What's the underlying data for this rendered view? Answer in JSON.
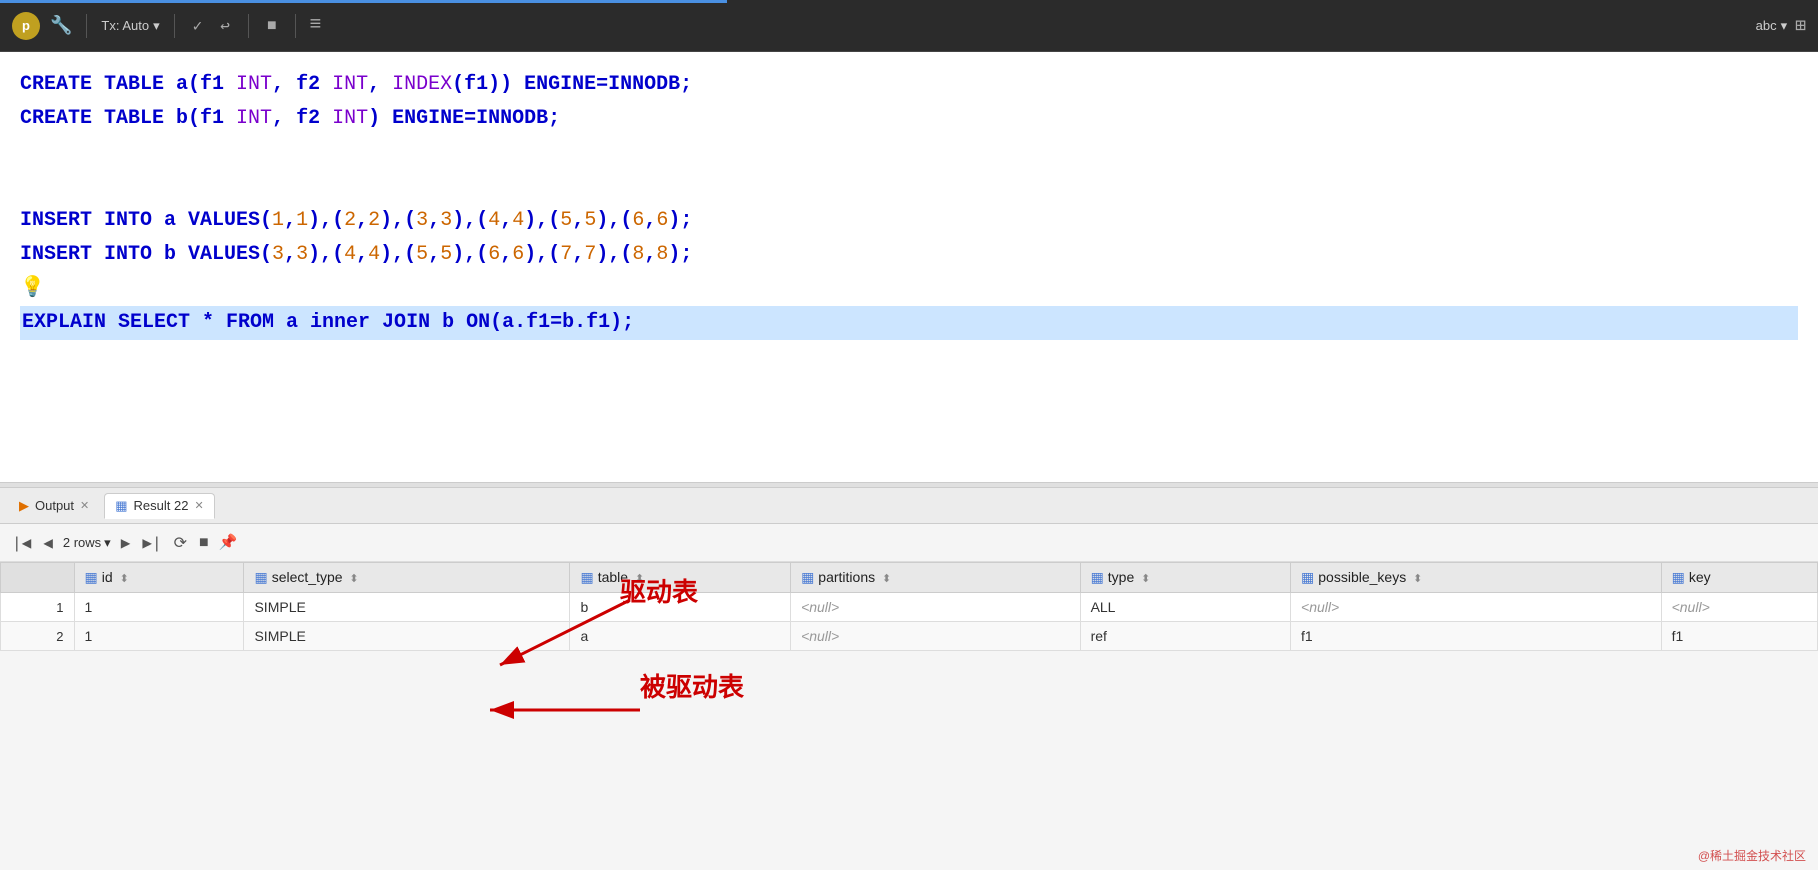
{
  "toolbar": {
    "avatar_label": "p",
    "tx_label": "Tx: Auto",
    "chevron": "▾",
    "check_icon": "✓",
    "undo_icon": "↩",
    "stop_icon": "■",
    "grid_icon": "≡",
    "abc_label": "abc",
    "abc_chevron": "▾",
    "right_icon": "⊞"
  },
  "editor": {
    "lines": [
      {
        "parts": [
          {
            "text": "CREATE TABLE a(f1 ",
            "cls": "kw"
          },
          {
            "text": "INT",
            "cls": "fn"
          },
          {
            "text": ", f2 ",
            "cls": "kw"
          },
          {
            "text": "INT",
            "cls": "fn"
          },
          {
            "text": ", ",
            "cls": "kw"
          },
          {
            "text": "INDEX",
            "cls": "fn"
          },
          {
            "text": "(f1)) ENGINE=INNODB;",
            "cls": "kw"
          }
        ]
      },
      {
        "parts": [
          {
            "text": "CREATE TABLE b(f1 ",
            "cls": "kw"
          },
          {
            "text": "INT",
            "cls": "fn"
          },
          {
            "text": ", f2 ",
            "cls": "kw"
          },
          {
            "text": "INT",
            "cls": "fn"
          },
          {
            "text": ") ENGINE=INNODB;",
            "cls": "kw"
          }
        ]
      },
      {
        "parts": [
          {
            "text": "",
            "cls": ""
          }
        ]
      },
      {
        "parts": [
          {
            "text": "",
            "cls": ""
          }
        ]
      },
      {
        "parts": [
          {
            "text": "INSERT INTO a VALUES(",
            "cls": "kw"
          },
          {
            "text": "1",
            "cls": "num"
          },
          {
            "text": ",",
            "cls": "kw"
          },
          {
            "text": "1",
            "cls": "num"
          },
          {
            "text": "),(",
            "cls": "kw"
          },
          {
            "text": "2",
            "cls": "num"
          },
          {
            "text": ",",
            "cls": "kw"
          },
          {
            "text": "2",
            "cls": "num"
          },
          {
            "text": "),(",
            "cls": "kw"
          },
          {
            "text": "3",
            "cls": "num"
          },
          {
            "text": ",",
            "cls": "kw"
          },
          {
            "text": "3",
            "cls": "num"
          },
          {
            "text": "),(",
            "cls": "kw"
          },
          {
            "text": "4",
            "cls": "num"
          },
          {
            "text": ",",
            "cls": "kw"
          },
          {
            "text": "4",
            "cls": "num"
          },
          {
            "text": "),(",
            "cls": "kw"
          },
          {
            "text": "5",
            "cls": "num"
          },
          {
            "text": ",",
            "cls": "kw"
          },
          {
            "text": "5",
            "cls": "num"
          },
          {
            "text": "),(",
            "cls": "kw"
          },
          {
            "text": "6",
            "cls": "num"
          },
          {
            "text": ",",
            "cls": "kw"
          },
          {
            "text": "6",
            "cls": "num"
          },
          {
            "text": ");",
            "cls": "kw"
          }
        ]
      },
      {
        "parts": [
          {
            "text": "INSERT INTO b VALUES(",
            "cls": "kw"
          },
          {
            "text": "3",
            "cls": "num"
          },
          {
            "text": ",",
            "cls": "kw"
          },
          {
            "text": "3",
            "cls": "num"
          },
          {
            "text": "),(",
            "cls": "kw"
          },
          {
            "text": "4",
            "cls": "num"
          },
          {
            "text": ",",
            "cls": "kw"
          },
          {
            "text": "4",
            "cls": "num"
          },
          {
            "text": "),(",
            "cls": "kw"
          },
          {
            "text": "5",
            "cls": "num"
          },
          {
            "text": ",",
            "cls": "kw"
          },
          {
            "text": "5",
            "cls": "num"
          },
          {
            "text": "),(",
            "cls": "kw"
          },
          {
            "text": "6",
            "cls": "num"
          },
          {
            "text": ",",
            "cls": "kw"
          },
          {
            "text": "6",
            "cls": "num"
          },
          {
            "text": "),(",
            "cls": "kw"
          },
          {
            "text": "7",
            "cls": "num"
          },
          {
            "text": ",",
            "cls": "kw"
          },
          {
            "text": "7",
            "cls": "num"
          },
          {
            "text": "),(",
            "cls": "kw"
          },
          {
            "text": "8",
            "cls": "num"
          },
          {
            "text": ",",
            "cls": "kw"
          },
          {
            "text": "8",
            "cls": "num"
          },
          {
            "text": ");",
            "cls": "kw"
          }
        ]
      },
      {
        "parts": [
          {
            "text": "💡",
            "cls": ""
          }
        ]
      },
      {
        "highlighted": true,
        "parts": [
          {
            "text": "EXPLAIN SELECT * FROM a inner JOIN b ON(a.f1=b.f1);",
            "cls": "kw"
          }
        ]
      }
    ]
  },
  "tabs": [
    {
      "label": "Output",
      "icon": "output",
      "active": false,
      "closable": true
    },
    {
      "label": "Result 22",
      "icon": "table",
      "active": true,
      "closable": true
    }
  ],
  "results_toolbar": {
    "first_icon": "|◀",
    "prev_icon": "◀",
    "rows_label": "2 rows",
    "rows_chevron": "▾",
    "next_icon": "▶",
    "last_icon": "▶|",
    "refresh_icon": "⟳",
    "stop_icon": "■",
    "pin_icon": "📌"
  },
  "table": {
    "columns": [
      "id",
      "select_type",
      "table",
      "partitions",
      "type",
      "possible_keys",
      "key"
    ],
    "rows": [
      {
        "id": "1",
        "select_type": "SIMPLE",
        "table": "b",
        "partitions": "<null>",
        "type": "ALL",
        "possible_keys": "<null>",
        "key": "<null>"
      },
      {
        "id": "1",
        "select_type": "SIMPLE",
        "table": "a",
        "partitions": "<null>",
        "type": "ref",
        "possible_keys": "f1",
        "key": "f1"
      }
    ]
  },
  "annotations": {
    "driver_label": "驱动表",
    "driven_label": "被驱动表"
  },
  "watermark": "@稀土掘金技术社区"
}
